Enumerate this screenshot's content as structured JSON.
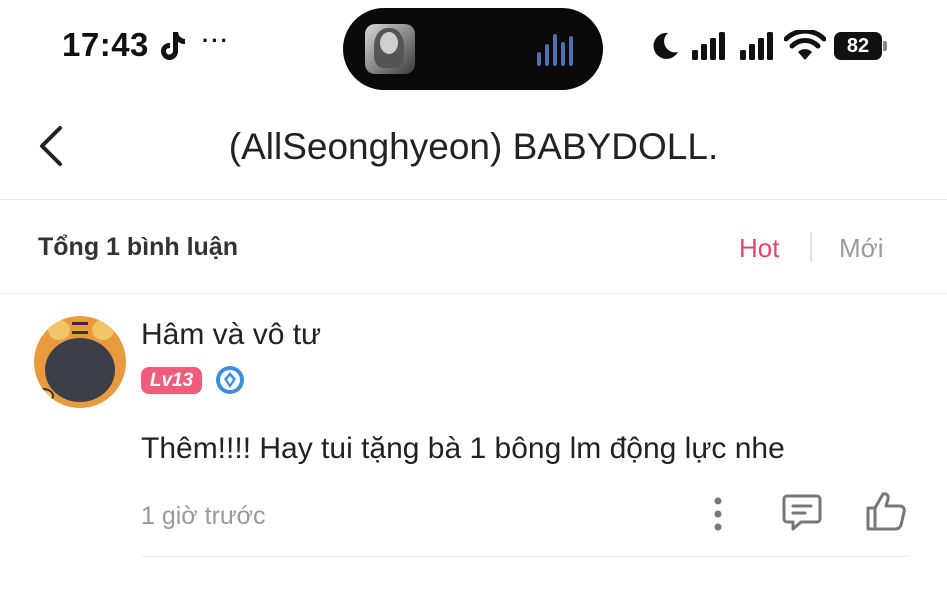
{
  "status_bar": {
    "time": "17:43",
    "more": "···",
    "battery": "82",
    "icons": [
      "tiktok-icon",
      "moon-icon",
      "signal-icon",
      "signal-icon",
      "wifi-icon",
      "battery-icon"
    ]
  },
  "dynamic_island": {
    "icons": [
      "album-art",
      "waveform-icon"
    ],
    "waveform_color": "#4d6fb0"
  },
  "header": {
    "title": "(AllSeonghyeon) BABYDOLL.",
    "back_icon": "chevron-left-icon"
  },
  "comments_bar": {
    "count_label": "Tổng 1 bình luận",
    "tabs": [
      {
        "label": "Hot",
        "active": true
      },
      {
        "label": "Mới",
        "active": false
      }
    ]
  },
  "comment": {
    "username": "Hâm và vô tư",
    "level": "Lv13",
    "text": "Thêm!!!! Hay tui tặng bà 1 bông lm động lực nhe",
    "time": "1 giờ trước",
    "actions": [
      "more-vertical-icon",
      "reply-icon",
      "like-icon"
    ]
  },
  "colors": {
    "accent": "#e0466f",
    "level_badge": "#f15b7c",
    "verified": "#3b8ee0",
    "muted_text": "#9a9a9a"
  }
}
